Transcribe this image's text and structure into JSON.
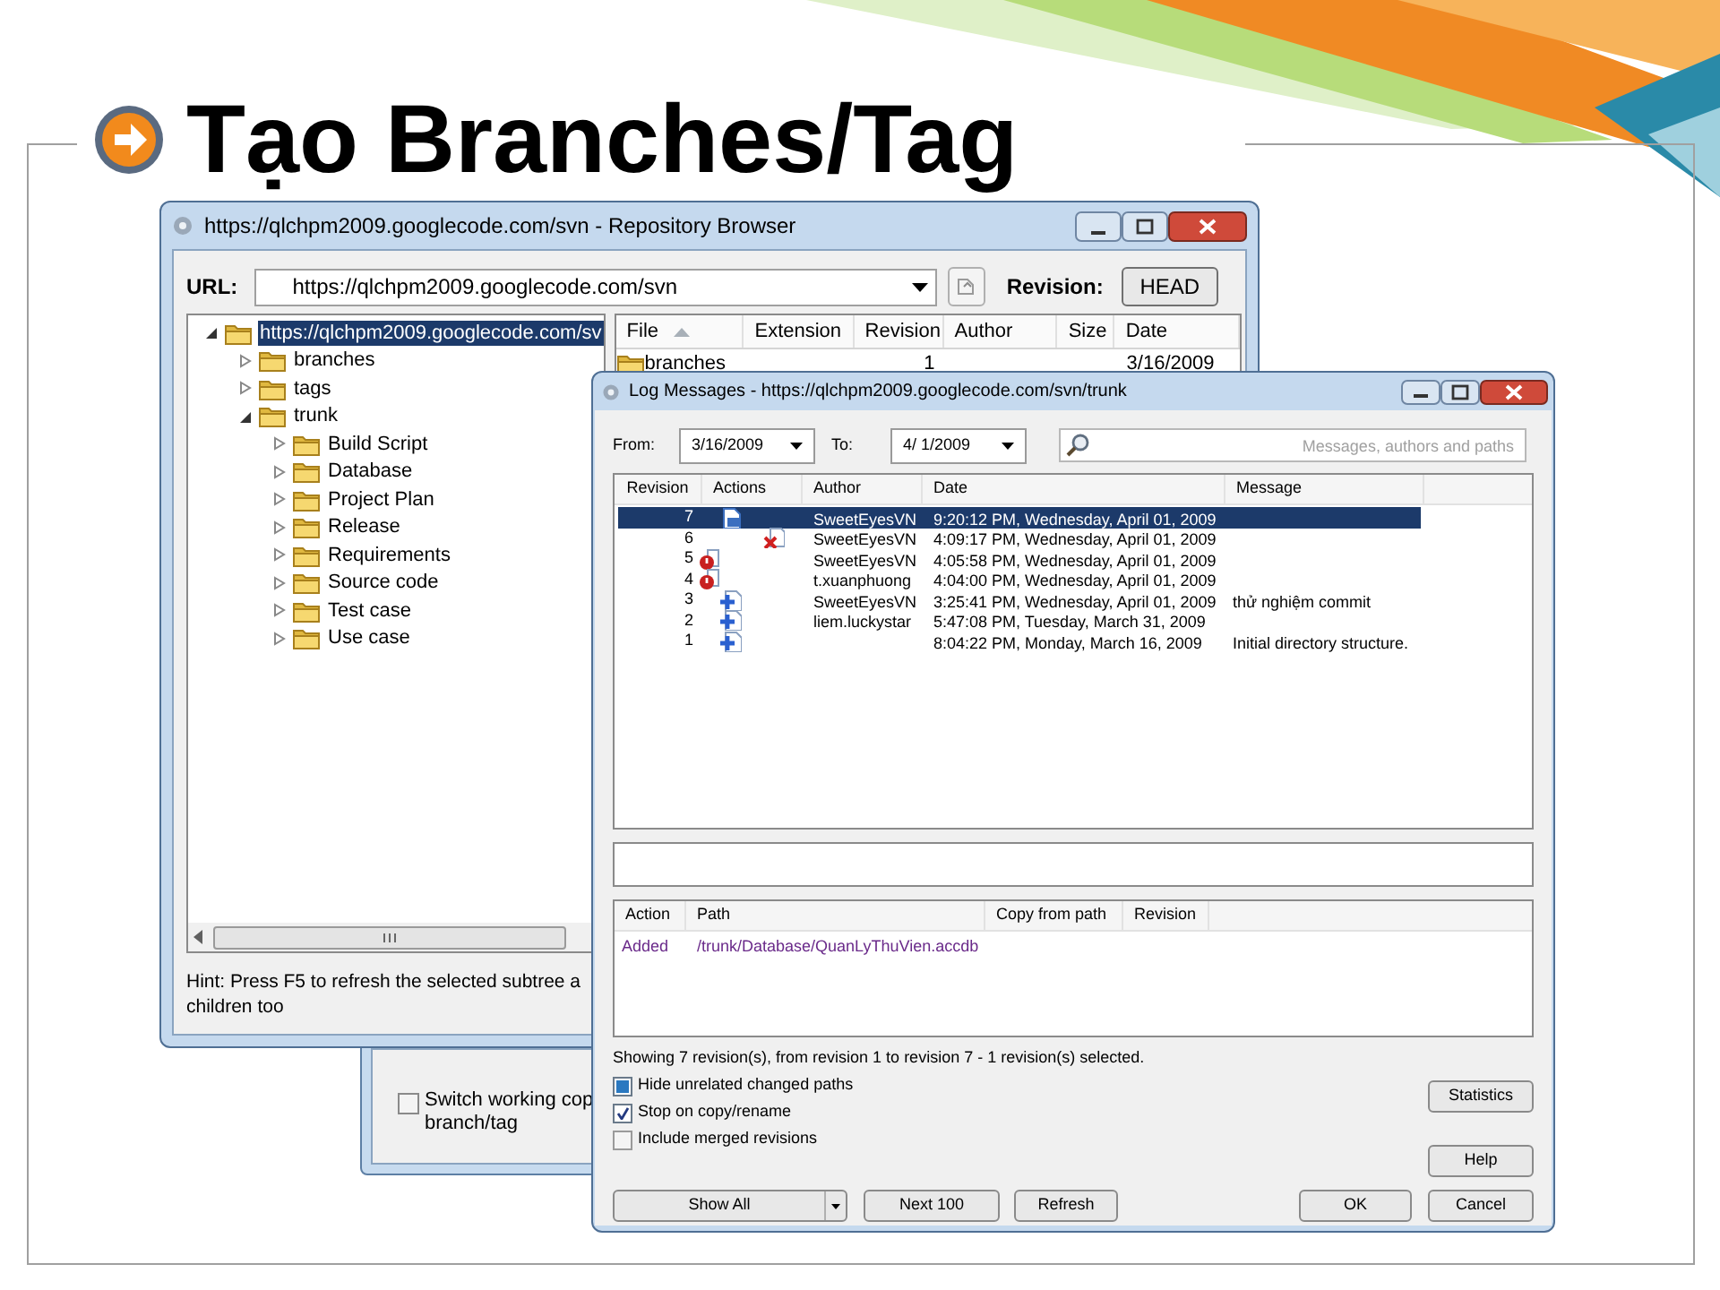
{
  "slide": {
    "title": "Tạo Branches/Tag"
  },
  "back_dialog": {
    "option": {
      "label": "Switch working cop\nbranch/tag",
      "checked": false
    }
  },
  "repo_browser": {
    "title": "https://qlchpm2009.googlecode.com/svn - Repository Browser",
    "url_label": "URL:",
    "url": "https://qlchpm2009.googlecode.com/svn",
    "revision_label": "Revision:",
    "revision_button": "HEAD",
    "tree": [
      {
        "label": "https://qlchpm2009.googlecode.com/sv",
        "selected": true,
        "expanded": true,
        "children": [
          {
            "label": "branches",
            "selected": false,
            "expanded": false
          },
          {
            "label": "tags",
            "selected": false,
            "expanded": false
          },
          {
            "label": "trunk",
            "selected": false,
            "expanded": true,
            "children": [
              {
                "label": "Build Script",
                "selected": false,
                "expanded": false
              },
              {
                "label": "Database",
                "selected": false,
                "expanded": false
              },
              {
                "label": "Project Plan",
                "selected": false,
                "expanded": false
              },
              {
                "label": "Release",
                "selected": false,
                "expanded": false
              },
              {
                "label": "Requirements",
                "selected": false,
                "expanded": false
              },
              {
                "label": "Source code",
                "selected": false,
                "expanded": false
              },
              {
                "label": "Test case",
                "selected": false,
                "expanded": false
              },
              {
                "label": "Use case",
                "selected": false,
                "expanded": false
              }
            ]
          }
        ]
      }
    ],
    "file_columns": [
      "File",
      "Extension",
      "Revision",
      "Author",
      "Size",
      "Date"
    ],
    "file_rows": [
      {
        "file": "branches",
        "revision": "1",
        "date": "3/16/2009"
      }
    ],
    "hint": "Hint: Press F5 to refresh the selected subtree a\nchildren too"
  },
  "log_window": {
    "title": "Log Messages - https://qlchpm2009.googlecode.com/svn/trunk",
    "from_label": "From:",
    "from": "3/16/2009",
    "to_label": "To:",
    "to": "4/ 1/2009",
    "search_placeholder": "Messages, authors and paths",
    "columns": [
      "Revision",
      "Actions",
      "Author",
      "Date",
      "Message"
    ],
    "rows": [
      {
        "revision": "7",
        "actions": [
          {
            "kind": "modified"
          }
        ],
        "author": "SweetEyesVN",
        "date": "9:20:12 PM, Wednesday, April 01, 2009",
        "selected": true
      },
      {
        "revision": "6",
        "actions": [
          {
            "kind": "deleted"
          }
        ],
        "author": "SweetEyesVN",
        "date": "4:09:17 PM, Wednesday, April 01, 2009",
        "selected": false
      },
      {
        "revision": "5",
        "actions": [
          {
            "kind": "replaced"
          }
        ],
        "author": "SweetEyesVN",
        "date": "4:05:58 PM, Wednesday, April 01, 2009",
        "selected": false
      },
      {
        "revision": "4",
        "actions": [
          {
            "kind": "replaced"
          }
        ],
        "author": "t.xuanphuong",
        "date": "4:04:00 PM, Wednesday, April 01, 2009",
        "selected": false
      },
      {
        "revision": "3",
        "actions": [
          {
            "kind": "added"
          }
        ],
        "author": "SweetEyesVN",
        "date": "3:25:41 PM, Wednesday, April 01, 2009",
        "message": "thử nghiệm commit",
        "selected": false
      },
      {
        "revision": "2",
        "actions": [
          {
            "kind": "added"
          }
        ],
        "author": "liem.luckystar",
        "date": "5:47:08 PM, Tuesday, March 31, 2009",
        "selected": false
      },
      {
        "revision": "1",
        "actions": [
          {
            "kind": "added"
          }
        ],
        "date": "8:04:22 PM, Monday, March 16, 2009",
        "message": "Initial directory structure.",
        "selected": false
      }
    ],
    "path_columns": [
      "Action",
      "Path",
      "Copy from path",
      "Revision"
    ],
    "path_rows": [
      {
        "action": "Added",
        "path": "/trunk/Database/QuanLyThuVien.accdb"
      }
    ],
    "status": "Showing 7 revision(s), from revision 1 to revision 7 - 1 revision(s) selected.",
    "options": [
      {
        "label": "Hide unrelated changed paths",
        "checked": true,
        "partial": true
      },
      {
        "label": "Stop on copy/rename",
        "checked": true
      },
      {
        "label": "Include merged revisions",
        "checked": false
      }
    ],
    "side_buttons": [
      "Statistics",
      "Help"
    ],
    "show_all_button": "Show All",
    "next_button": "Next 100",
    "refresh_button": "Refresh",
    "ok_button": "OK",
    "cancel_button": "Cancel"
  }
}
